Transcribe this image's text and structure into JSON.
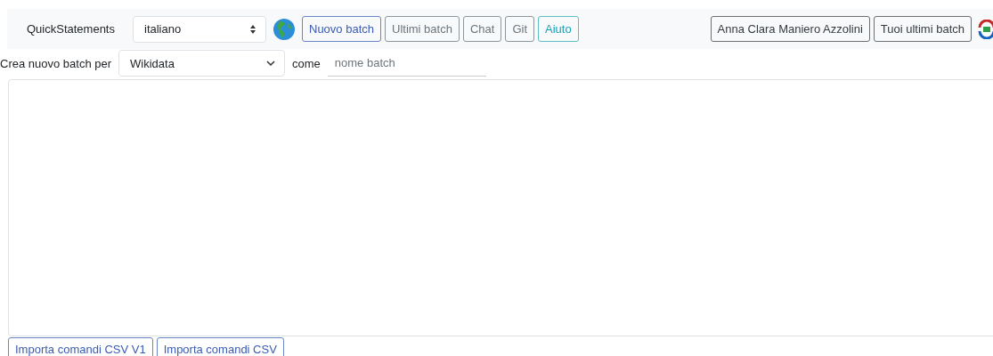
{
  "navbar": {
    "brand": "QuickStatements",
    "language": {
      "value": "italiano"
    },
    "buttons": [
      {
        "label": "Nuovo batch",
        "kind": "primary"
      },
      {
        "label": "Ultimi batch",
        "kind": "secondary"
      },
      {
        "label": "Chat",
        "kind": "secondary"
      },
      {
        "label": "Git",
        "kind": "secondary"
      },
      {
        "label": "Aiuto",
        "kind": "info"
      }
    ],
    "user_button": "Anna Clara Maniero Azzolini",
    "batches_button": "Tuoi ultimi batch"
  },
  "new_batch": {
    "label": "Crea nuovo batch per",
    "site": "Wikidata",
    "as_label": "come",
    "name_field": {
      "placeholder": "nome batch"
    }
  },
  "import_buttons": [
    "Importa comandi CSV V1",
    "Importa comandi CSV"
  ]
}
